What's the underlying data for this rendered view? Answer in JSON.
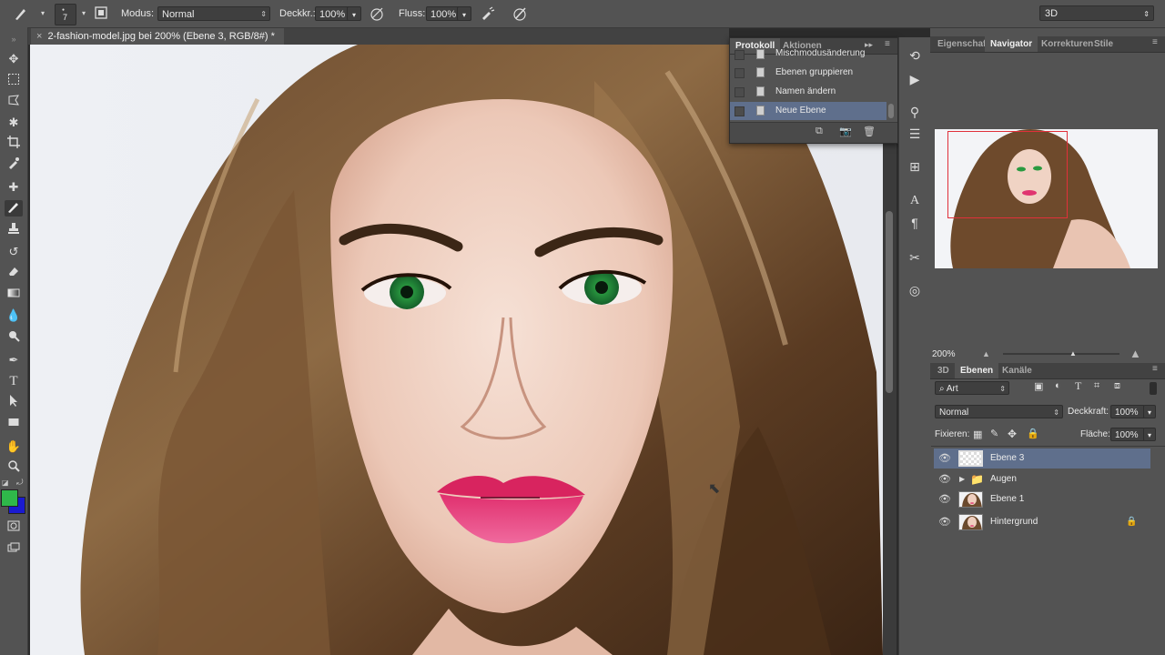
{
  "options_bar": {
    "brush_size": "7",
    "mode_label": "Modus:",
    "mode_value": "Normal",
    "opacity_label": "Deckkr.:",
    "opacity_value": "100%",
    "flow_label": "Fluss:",
    "flow_value": "100%",
    "workspace": "3D"
  },
  "document": {
    "tab_title": "2-fashion-model.jpg bei 200% (Ebene 3, RGB/8#) *",
    "close_glyph": "×"
  },
  "history_panel": {
    "tabs": [
      "Protokoll",
      "Aktionen"
    ],
    "items": [
      {
        "label": "Mischmodusänderung",
        "selected": false
      },
      {
        "label": "Ebenen gruppieren",
        "selected": false
      },
      {
        "label": "Namen ändern",
        "selected": false
      },
      {
        "label": "Neue Ebene",
        "selected": true
      }
    ]
  },
  "top_right_panel": {
    "tabs": [
      "Eigenschaft",
      "Navigator",
      "Korrekturen",
      "Stile"
    ],
    "active_tab": "Navigator",
    "zoom": "200%"
  },
  "layers_panel": {
    "tabs": [
      "3D",
      "Ebenen",
      "Kanäle"
    ],
    "active_tab": "Ebenen",
    "filter_kind": "Art",
    "blend_mode": "Normal",
    "opacity_label": "Deckkraft:",
    "opacity_value": "100%",
    "lock_label": "Fixieren:",
    "fill_label": "Fläche:",
    "fill_value": "100%",
    "layers": [
      {
        "name": "Ebene 3",
        "type": "empty",
        "selected": true,
        "locked": false
      },
      {
        "name": "Augen",
        "type": "group",
        "selected": false,
        "locked": false
      },
      {
        "name": "Ebene 1",
        "type": "photo",
        "selected": false,
        "locked": false
      },
      {
        "name": "Hintergrund",
        "type": "photo",
        "selected": false,
        "locked": true
      }
    ]
  },
  "colors": {
    "foreground": "#2fb84a",
    "background": "#1a1ad0",
    "selection": "#5f6f8c",
    "navigator_view_rect": "#e0303a"
  }
}
